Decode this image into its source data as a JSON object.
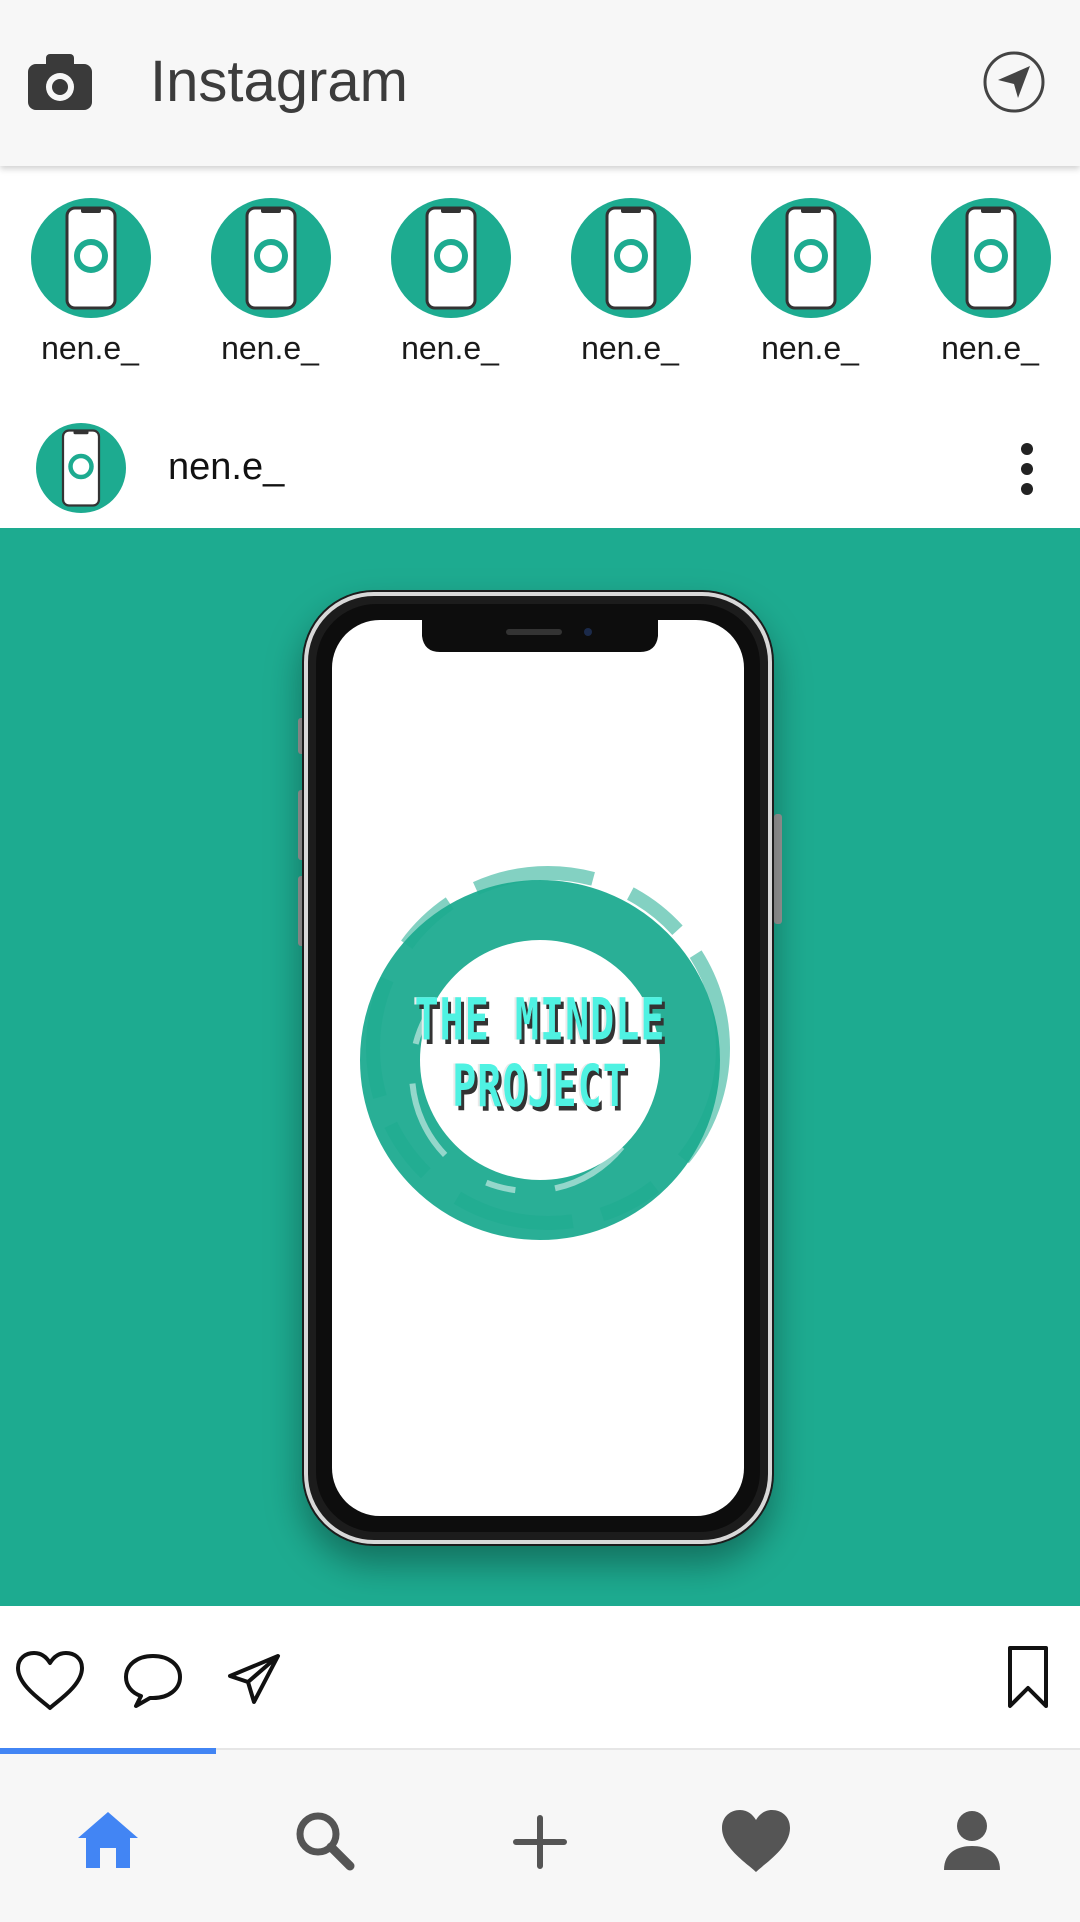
{
  "app": {
    "title": "Instagram"
  },
  "colors": {
    "brand_teal": "#1dab90",
    "nav_active": "#4285f4",
    "icon_gray": "#555555"
  },
  "stories": [
    {
      "username": "nen.e_"
    },
    {
      "username": "nen.e_"
    },
    {
      "username": "nen.e_"
    },
    {
      "username": "nen.e_"
    },
    {
      "username": "nen.e_"
    },
    {
      "username": "nen.e_"
    }
  ],
  "post": {
    "username": "nen.e_",
    "image_text": "THE MINDLE PROJECT"
  },
  "actions": [
    "heart-icon",
    "comment-icon",
    "share-icon",
    "bookmark-icon"
  ],
  "bottom_nav": [
    {
      "icon": "home-icon",
      "active": true
    },
    {
      "icon": "search-icon",
      "active": false
    },
    {
      "icon": "add-icon",
      "active": false
    },
    {
      "icon": "heart-filled-icon",
      "active": false
    },
    {
      "icon": "profile-icon",
      "active": false
    }
  ]
}
